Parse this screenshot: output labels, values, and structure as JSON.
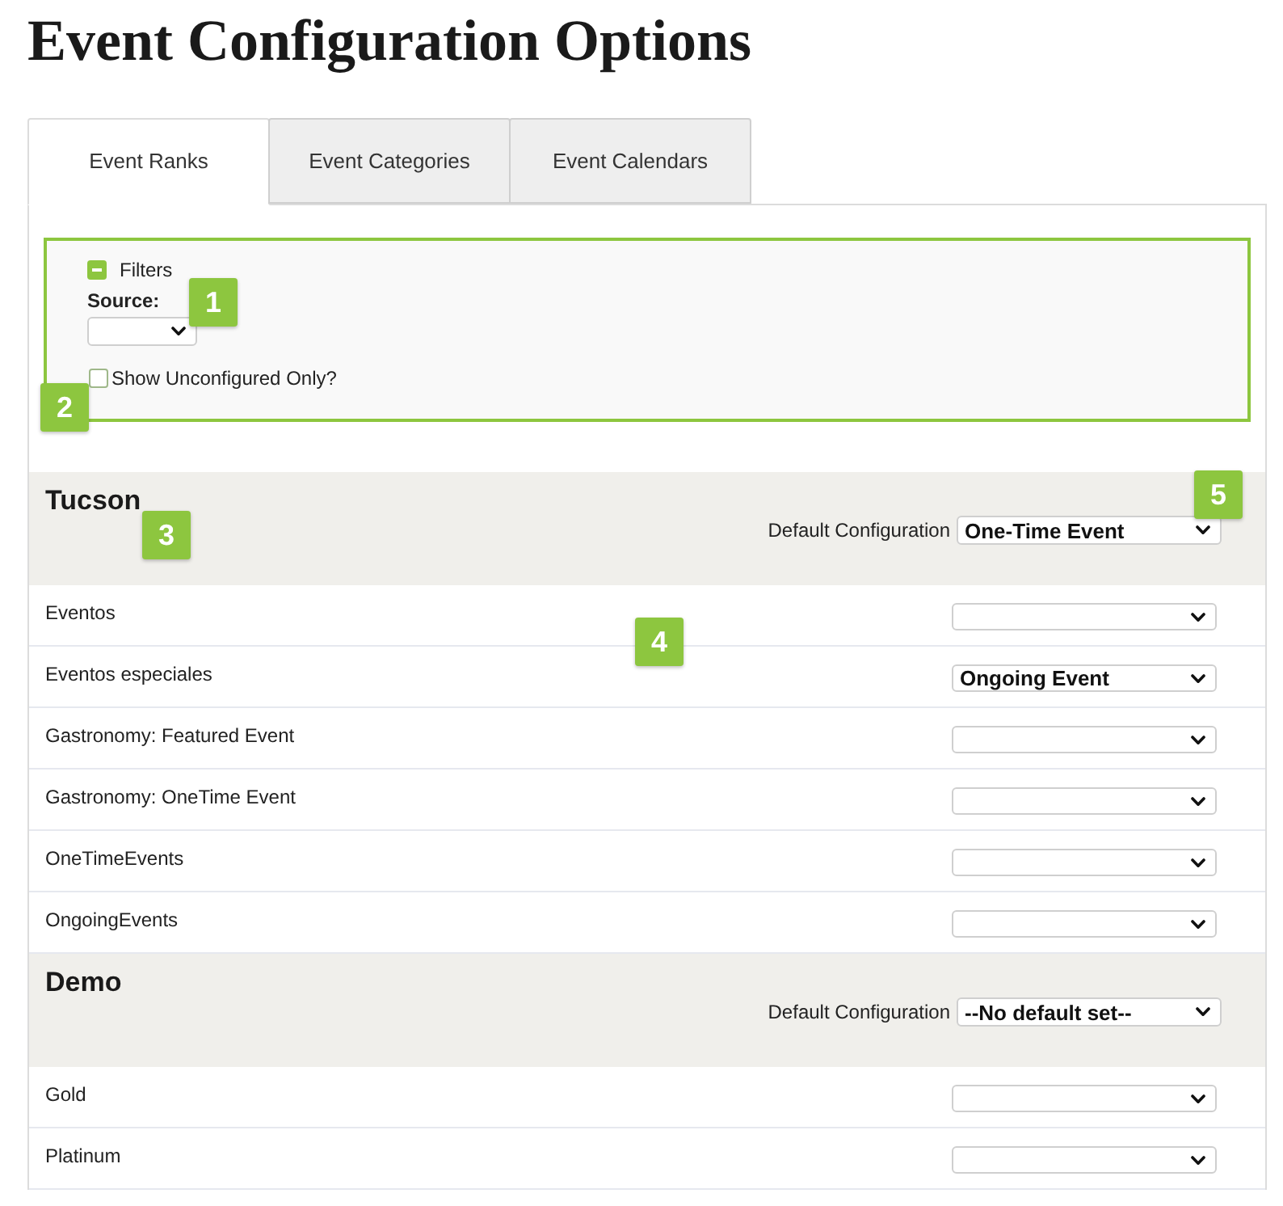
{
  "page": {
    "title": "Event Configuration Options"
  },
  "tabs": [
    {
      "label": "Event Ranks",
      "selected": true
    },
    {
      "label": "Event Categories",
      "selected": false
    },
    {
      "label": "Event Calendars",
      "selected": false
    }
  ],
  "filters": {
    "title": "Filters",
    "expanded": true,
    "source": {
      "label": "Source:",
      "callout": "1"
    },
    "show_unconfigured": {
      "label": "Show Unconfigured Only?",
      "checked": false,
      "callout": "2"
    }
  },
  "groups": [
    {
      "name": "Tucson",
      "callout": "3",
      "default_config": {
        "label": "Default Configuration",
        "value": "One-Time Event",
        "callout": "5"
      },
      "rows": [
        {
          "label": "Eventos",
          "callout": "4"
        },
        {
          "label": "Eventos especiales",
          "value": "Ongoing Event"
        },
        {
          "label": "Gastronomy: Featured Event"
        },
        {
          "label": "Gastronomy: OneTime Event"
        },
        {
          "label": "OneTimeEvents"
        },
        {
          "label": "OngoingEvents"
        }
      ]
    },
    {
      "name": "Demo",
      "default_config": {
        "label": "Default Configuration",
        "value": "--No default set--"
      },
      "rows": [
        {
          "label": "Gold"
        },
        {
          "label": "Platinum"
        }
      ]
    }
  ]
}
